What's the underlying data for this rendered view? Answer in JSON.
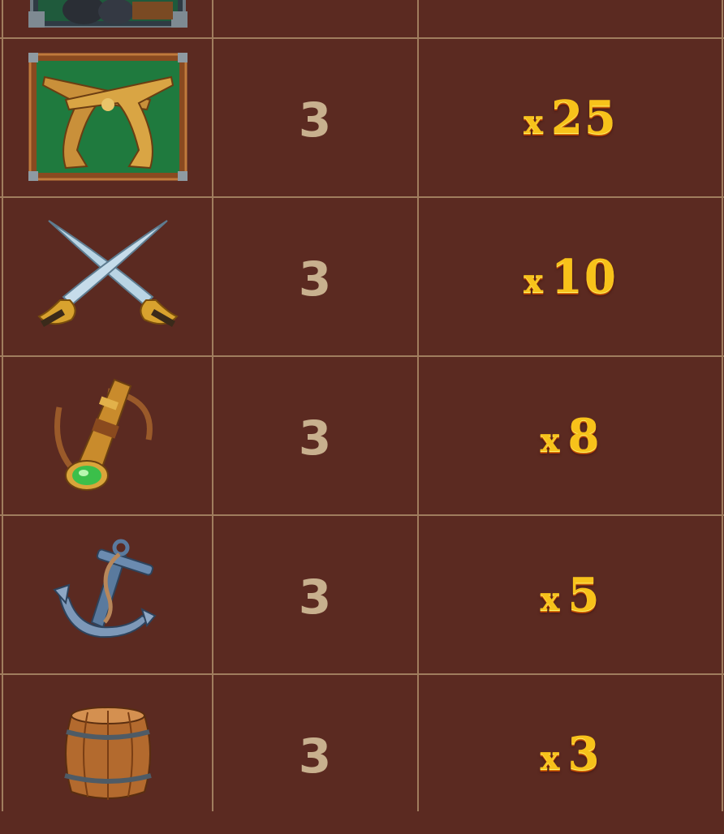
{
  "paytable": {
    "rows": [
      {
        "symbol": "cannon",
        "icon": "cannon-icon",
        "count": "",
        "multiplier": "",
        "x": ""
      },
      {
        "symbol": "pistols",
        "icon": "crossed-pistols-icon",
        "count": "3",
        "multiplier": "25",
        "x": "x"
      },
      {
        "symbol": "swords",
        "icon": "crossed-swords-icon",
        "count": "3",
        "multiplier": "10",
        "x": "x"
      },
      {
        "symbol": "spyglass",
        "icon": "spyglass-icon",
        "count": "3",
        "multiplier": "8",
        "x": "x"
      },
      {
        "symbol": "anchor",
        "icon": "anchor-icon",
        "count": "3",
        "multiplier": "5",
        "x": "x"
      },
      {
        "symbol": "barrel",
        "icon": "barrel-icon",
        "count": "3",
        "multiplier": "3",
        "x": "x"
      }
    ]
  },
  "colors": {
    "background": "#5b2a21",
    "grid_line": "#a07d5e",
    "count_text": "#c8b08e",
    "multiplier_gold": "#f7c21a"
  }
}
